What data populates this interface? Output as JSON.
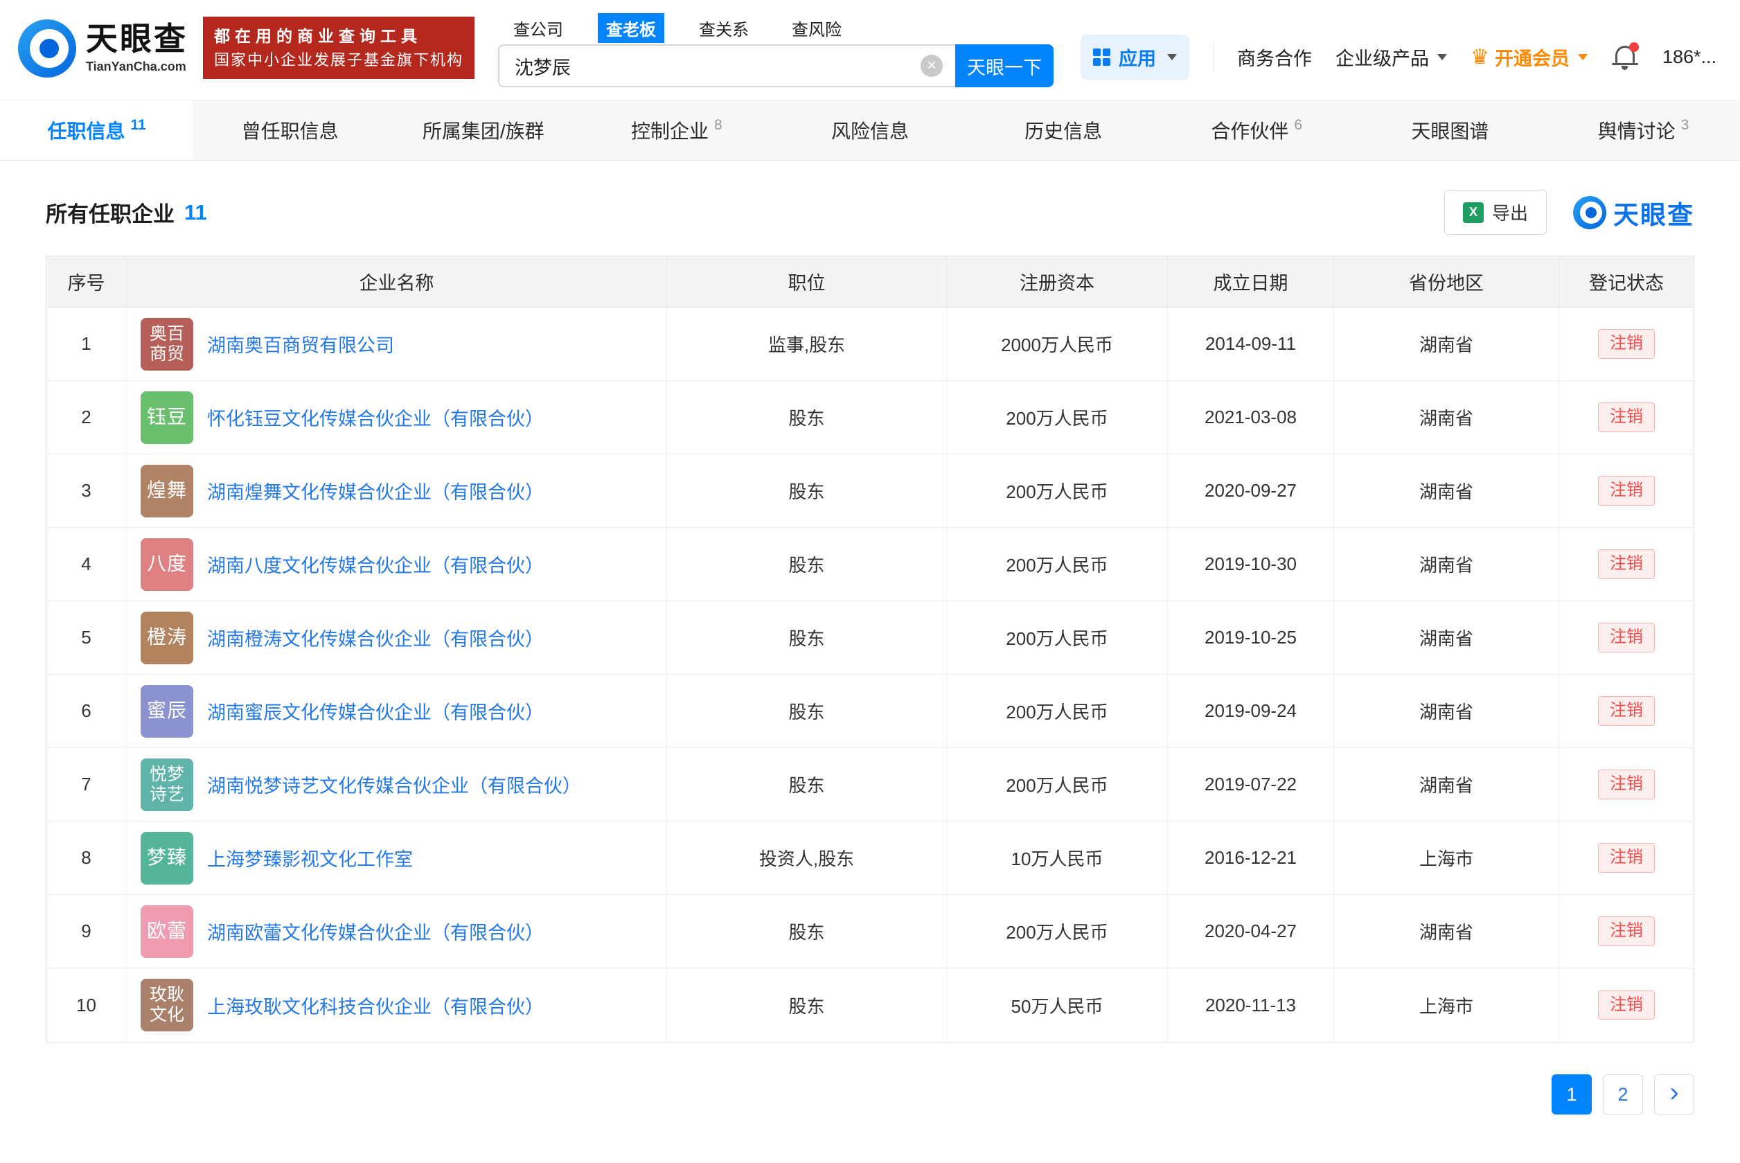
{
  "brand": {
    "name": "天眼查",
    "domain": "TianYanCha.com",
    "accent": "#0084ff"
  },
  "promo": {
    "line1": "都在用的商业查询工具",
    "line2": "国家中小企业发展子基金旗下机构",
    "bg": "#b5281e"
  },
  "icons": {
    "clear": "×",
    "crown": "♛",
    "excel": "X",
    "next": "›"
  },
  "search": {
    "tabs": [
      {
        "label": "查公司",
        "active": false
      },
      {
        "label": "查老板",
        "active": true
      },
      {
        "label": "查关系",
        "active": false
      },
      {
        "label": "查风险",
        "active": false
      }
    ],
    "value": "沈梦辰",
    "button_label": "天眼一下"
  },
  "header_right": {
    "apps_label": "应用",
    "biz_label": "商务合作",
    "enterprise_label": "企业级产品",
    "vip_label": "开通会员",
    "user_label": "186*..."
  },
  "nav_tabs": [
    {
      "label": "任职信息",
      "count": "11",
      "active": true
    },
    {
      "label": "曾任职信息",
      "count": "",
      "active": false
    },
    {
      "label": "所属集团/族群",
      "count": "",
      "active": false
    },
    {
      "label": "控制企业",
      "count": "8",
      "active": false
    },
    {
      "label": "风险信息",
      "count": "",
      "active": false
    },
    {
      "label": "历史信息",
      "count": "",
      "active": false
    },
    {
      "label": "合作伙伴",
      "count": "6",
      "active": false
    },
    {
      "label": "天眼图谱",
      "count": "",
      "active": false
    },
    {
      "label": "舆情讨论",
      "count": "3",
      "active": false
    }
  ],
  "section": {
    "title": "所有任职企业",
    "count": "11",
    "export_label": "导出",
    "logo_text": "天眼查"
  },
  "table": {
    "headers": [
      "序号",
      "企业名称",
      "职位",
      "注册资本",
      "成立日期",
      "省份地区",
      "登记状态"
    ],
    "status_colors": {
      "text": "#f04b4b",
      "bg": "#fdeeee",
      "border": "#f5b3b3"
    },
    "rows": [
      {
        "no": "1",
        "icon": {
          "lines": [
            "奥百",
            "商贸"
          ],
          "color": "#b55f58"
        },
        "name": "湖南奥百商贸有限公司",
        "position": "监事,股东",
        "capital": "2000万人民币",
        "date": "2014-09-11",
        "region": "湖南省",
        "status": "注销"
      },
      {
        "no": "2",
        "icon": {
          "lines": [
            "钰豆"
          ],
          "color": "#6abf6e"
        },
        "name": "怀化钰豆文化传媒合伙企业（有限合伙）",
        "position": "股东",
        "capital": "200万人民币",
        "date": "2021-03-08",
        "region": "湖南省",
        "status": "注销"
      },
      {
        "no": "3",
        "icon": {
          "lines": [
            "煌舞"
          ],
          "color": "#b18365"
        },
        "name": "湖南煌舞文化传媒合伙企业（有限合伙）",
        "position": "股东",
        "capital": "200万人民币",
        "date": "2020-09-27",
        "region": "湖南省",
        "status": "注销"
      },
      {
        "no": "4",
        "icon": {
          "lines": [
            "八度"
          ],
          "color": "#df8083"
        },
        "name": "湖南八度文化传媒合伙企业（有限合伙）",
        "position": "股东",
        "capital": "200万人民币",
        "date": "2019-10-30",
        "region": "湖南省",
        "status": "注销"
      },
      {
        "no": "5",
        "icon": {
          "lines": [
            "橙涛"
          ],
          "color": "#b1835f"
        },
        "name": "湖南橙涛文化传媒合伙企业（有限合伙）",
        "position": "股东",
        "capital": "200万人民币",
        "date": "2019-10-25",
        "region": "湖南省",
        "status": "注销"
      },
      {
        "no": "6",
        "icon": {
          "lines": [
            "蜜辰"
          ],
          "color": "#8a93cf"
        },
        "name": "湖南蜜辰文化传媒合伙企业（有限合伙）",
        "position": "股东",
        "capital": "200万人民币",
        "date": "2019-09-24",
        "region": "湖南省",
        "status": "注销"
      },
      {
        "no": "7",
        "icon": {
          "lines": [
            "悦梦",
            "诗艺"
          ],
          "color": "#5fb3a8"
        },
        "name": "湖南悦梦诗艺文化传媒合伙企业（有限合伙）",
        "position": "股东",
        "capital": "200万人民币",
        "date": "2019-07-22",
        "region": "湖南省",
        "status": "注销"
      },
      {
        "no": "8",
        "icon": {
          "lines": [
            "梦臻"
          ],
          "color": "#54b59b"
        },
        "name": "上海梦臻影视文化工作室",
        "position": "投资人,股东",
        "capital": "10万人民币",
        "date": "2016-12-21",
        "region": "上海市",
        "status": "注销"
      },
      {
        "no": "9",
        "icon": {
          "lines": [
            "欧蕾"
          ],
          "color": "#f09cb0"
        },
        "name": "湖南欧蕾文化传媒合伙企业（有限合伙）",
        "position": "股东",
        "capital": "200万人民币",
        "date": "2020-04-27",
        "region": "湖南省",
        "status": "注销"
      },
      {
        "no": "10",
        "icon": {
          "lines": [
            "玫耿",
            "文化"
          ],
          "color": "#a98069"
        },
        "name": "上海玫耿文化科技合伙企业（有限合伙）",
        "position": "股东",
        "capital": "50万人民币",
        "date": "2020-11-13",
        "region": "上海市",
        "status": "注销"
      }
    ]
  },
  "pagination": {
    "pages": [
      "1",
      "2"
    ],
    "current": "1"
  }
}
